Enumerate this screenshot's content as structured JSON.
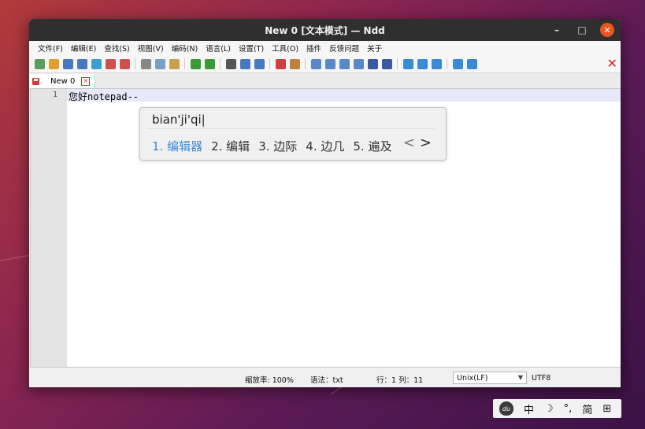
{
  "window": {
    "title": "New 0 [文本模式] — Ndd"
  },
  "menu": [
    {
      "label": "文件(F)"
    },
    {
      "label": "编辑(E)"
    },
    {
      "label": "查找(S)"
    },
    {
      "label": "视图(V)"
    },
    {
      "label": "编码(N)"
    },
    {
      "label": "语言(L)"
    },
    {
      "label": "设置(T)"
    },
    {
      "label": "工具(O)"
    },
    {
      "label": "插件"
    },
    {
      "label": "反馈问题"
    },
    {
      "label": "关于"
    }
  ],
  "toolbar": [
    {
      "icon": "new-file-icon",
      "color": "#5aa05a"
    },
    {
      "icon": "open-file-icon",
      "color": "#e0a030"
    },
    {
      "icon": "save-icon",
      "color": "#4a78c0"
    },
    {
      "icon": "save-all-icon",
      "color": "#4a78c0"
    },
    {
      "icon": "close-file-icon",
      "color": "#3aa0d0"
    },
    {
      "icon": "close-all-icon",
      "color": "#d05050"
    },
    {
      "icon": "print-icon",
      "color": "#d05050"
    },
    {
      "icon": "cut-icon",
      "color": "#888888"
    },
    {
      "icon": "copy-icon",
      "color": "#7aa0c8"
    },
    {
      "icon": "paste-icon",
      "color": "#c8a050"
    },
    {
      "icon": "undo-icon",
      "color": "#3a9a3a"
    },
    {
      "icon": "redo-icon",
      "color": "#3a9a3a"
    },
    {
      "icon": "find-icon",
      "color": "#555555"
    },
    {
      "icon": "replace-icon",
      "color": "#4a78c0"
    },
    {
      "icon": "find-in-files-icon",
      "color": "#4a78c0"
    },
    {
      "icon": "marker-icon",
      "color": "#d04040"
    },
    {
      "icon": "pen-icon",
      "color": "#c08040"
    },
    {
      "icon": "zoom-in-icon",
      "color": "#5a88c8"
    },
    {
      "icon": "zoom-out-icon",
      "color": "#5a88c8"
    },
    {
      "icon": "wrap-icon",
      "color": "#5a88c8"
    },
    {
      "icon": "show-symbols-icon",
      "color": "#5a88c8"
    },
    {
      "icon": "indent-guide-icon",
      "color": "#3a5aa0"
    },
    {
      "icon": "target-icon",
      "color": "#3a5aa0"
    },
    {
      "icon": "prev-icon",
      "color": "#3a8ad6"
    },
    {
      "icon": "next-icon",
      "color": "#3a8ad6"
    },
    {
      "icon": "compare-icon",
      "color": "#3a8ad6"
    },
    {
      "icon": "structure-icon",
      "color": "#3a8ad6"
    },
    {
      "icon": "text-mode-icon",
      "color": "#3a8ad6"
    }
  ],
  "tab": {
    "label": "New 0"
  },
  "editor": {
    "line_number": "1",
    "line_text": "您好notepad--"
  },
  "ime": {
    "preedit": "bian'ji'qi|",
    "candidates": [
      "1. 编辑器",
      "2. 编辑",
      "3. 边际",
      "4. 边几",
      "5. 遍及"
    ],
    "prev": "<",
    "next": ">"
  },
  "status": {
    "zoom": "缩放率: 100%",
    "syntax": "语法：txt",
    "position": "行：1 列：11",
    "eol": "Unix(LF)",
    "encoding": "UTF8"
  },
  "tray": {
    "logo": "du",
    "lang": "中",
    "moon": "☽",
    "punct": "°,",
    "simplified": "简",
    "grid": "⊞"
  }
}
